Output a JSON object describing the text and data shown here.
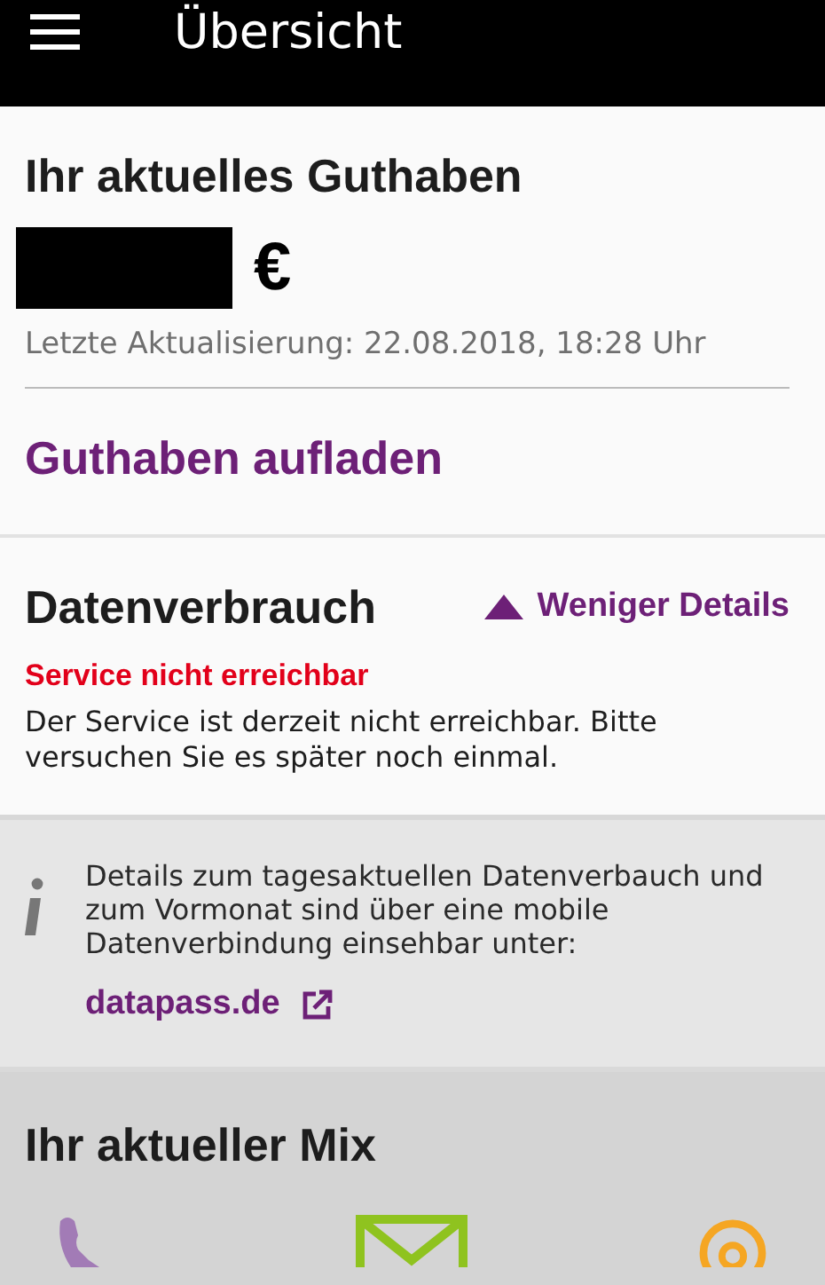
{
  "header": {
    "title": "Übersicht"
  },
  "balance": {
    "title": "Ihr aktuelles Guthaben",
    "currency": "€",
    "updated": "Letzte Aktualisierung: 22.08.2018, 18:28 Uhr",
    "topup_link": "Guthaben aufladen"
  },
  "data_usage": {
    "title": "Datenverbrauch",
    "toggle": {
      "label": "Weniger Details",
      "expanded": true
    },
    "error_title": "Service nicht erreichbar",
    "error_text": "Der Service ist derzeit nicht erreichbar. Bitte versuchen Sie es später noch einmal."
  },
  "info": {
    "text": "Details zum tagesaktuellen Datenverbauch und zum Vormonat sind über eine mobile Datenverbindung einsehbar unter:",
    "link": "datapass.de"
  },
  "mix": {
    "title": "Ihr aktueller Mix",
    "items": [
      {
        "kind": "phone",
        "color": "#a27bb6"
      },
      {
        "kind": "sms",
        "color": "#8fc31f"
      },
      {
        "kind": "data",
        "color": "#f5a623"
      }
    ]
  }
}
